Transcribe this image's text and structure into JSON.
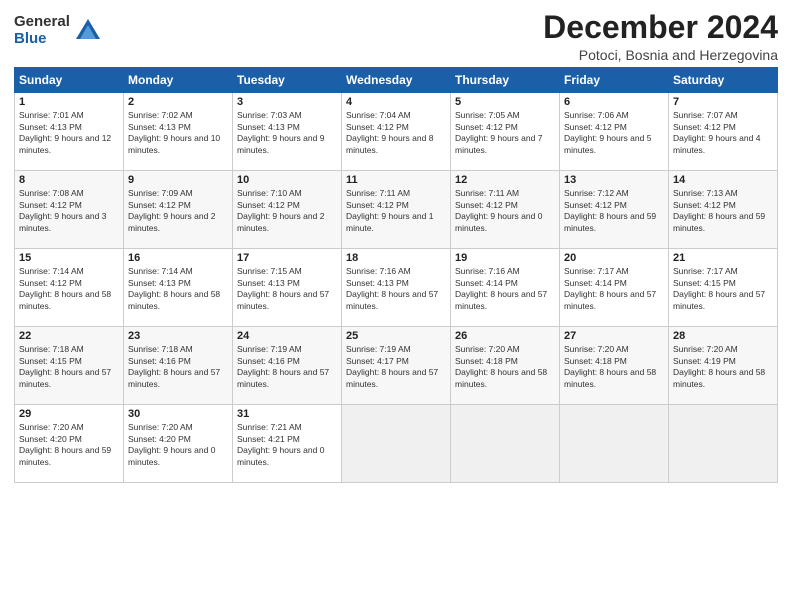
{
  "logo": {
    "general": "General",
    "blue": "Blue"
  },
  "title": "December 2024",
  "location": "Potoci, Bosnia and Herzegovina",
  "days_of_week": [
    "Sunday",
    "Monday",
    "Tuesday",
    "Wednesday",
    "Thursday",
    "Friday",
    "Saturday"
  ],
  "weeks": [
    [
      {
        "day": "1",
        "sunrise": "7:01 AM",
        "sunset": "4:13 PM",
        "daylight": "9 hours and 12 minutes."
      },
      {
        "day": "2",
        "sunrise": "7:02 AM",
        "sunset": "4:13 PM",
        "daylight": "9 hours and 10 minutes."
      },
      {
        "day": "3",
        "sunrise": "7:03 AM",
        "sunset": "4:13 PM",
        "daylight": "9 hours and 9 minutes."
      },
      {
        "day": "4",
        "sunrise": "7:04 AM",
        "sunset": "4:12 PM",
        "daylight": "9 hours and 8 minutes."
      },
      {
        "day": "5",
        "sunrise": "7:05 AM",
        "sunset": "4:12 PM",
        "daylight": "9 hours and 7 minutes."
      },
      {
        "day": "6",
        "sunrise": "7:06 AM",
        "sunset": "4:12 PM",
        "daylight": "9 hours and 5 minutes."
      },
      {
        "day": "7",
        "sunrise": "7:07 AM",
        "sunset": "4:12 PM",
        "daylight": "9 hours and 4 minutes."
      }
    ],
    [
      {
        "day": "8",
        "sunrise": "7:08 AM",
        "sunset": "4:12 PM",
        "daylight": "9 hours and 3 minutes."
      },
      {
        "day": "9",
        "sunrise": "7:09 AM",
        "sunset": "4:12 PM",
        "daylight": "9 hours and 2 minutes."
      },
      {
        "day": "10",
        "sunrise": "7:10 AM",
        "sunset": "4:12 PM",
        "daylight": "9 hours and 2 minutes."
      },
      {
        "day": "11",
        "sunrise": "7:11 AM",
        "sunset": "4:12 PM",
        "daylight": "9 hours and 1 minute."
      },
      {
        "day": "12",
        "sunrise": "7:11 AM",
        "sunset": "4:12 PM",
        "daylight": "9 hours and 0 minutes."
      },
      {
        "day": "13",
        "sunrise": "7:12 AM",
        "sunset": "4:12 PM",
        "daylight": "8 hours and 59 minutes."
      },
      {
        "day": "14",
        "sunrise": "7:13 AM",
        "sunset": "4:12 PM",
        "daylight": "8 hours and 59 minutes."
      }
    ],
    [
      {
        "day": "15",
        "sunrise": "7:14 AM",
        "sunset": "4:12 PM",
        "daylight": "8 hours and 58 minutes."
      },
      {
        "day": "16",
        "sunrise": "7:14 AM",
        "sunset": "4:13 PM",
        "daylight": "8 hours and 58 minutes."
      },
      {
        "day": "17",
        "sunrise": "7:15 AM",
        "sunset": "4:13 PM",
        "daylight": "8 hours and 57 minutes."
      },
      {
        "day": "18",
        "sunrise": "7:16 AM",
        "sunset": "4:13 PM",
        "daylight": "8 hours and 57 minutes."
      },
      {
        "day": "19",
        "sunrise": "7:16 AM",
        "sunset": "4:14 PM",
        "daylight": "8 hours and 57 minutes."
      },
      {
        "day": "20",
        "sunrise": "7:17 AM",
        "sunset": "4:14 PM",
        "daylight": "8 hours and 57 minutes."
      },
      {
        "day": "21",
        "sunrise": "7:17 AM",
        "sunset": "4:15 PM",
        "daylight": "8 hours and 57 minutes."
      }
    ],
    [
      {
        "day": "22",
        "sunrise": "7:18 AM",
        "sunset": "4:15 PM",
        "daylight": "8 hours and 57 minutes."
      },
      {
        "day": "23",
        "sunrise": "7:18 AM",
        "sunset": "4:16 PM",
        "daylight": "8 hours and 57 minutes."
      },
      {
        "day": "24",
        "sunrise": "7:19 AM",
        "sunset": "4:16 PM",
        "daylight": "8 hours and 57 minutes."
      },
      {
        "day": "25",
        "sunrise": "7:19 AM",
        "sunset": "4:17 PM",
        "daylight": "8 hours and 57 minutes."
      },
      {
        "day": "26",
        "sunrise": "7:20 AM",
        "sunset": "4:18 PM",
        "daylight": "8 hours and 58 minutes."
      },
      {
        "day": "27",
        "sunrise": "7:20 AM",
        "sunset": "4:18 PM",
        "daylight": "8 hours and 58 minutes."
      },
      {
        "day": "28",
        "sunrise": "7:20 AM",
        "sunset": "4:19 PM",
        "daylight": "8 hours and 58 minutes."
      }
    ],
    [
      {
        "day": "29",
        "sunrise": "7:20 AM",
        "sunset": "4:20 PM",
        "daylight": "8 hours and 59 minutes."
      },
      {
        "day": "30",
        "sunrise": "7:20 AM",
        "sunset": "4:20 PM",
        "daylight": "9 hours and 0 minutes."
      },
      {
        "day": "31",
        "sunrise": "7:21 AM",
        "sunset": "4:21 PM",
        "daylight": "9 hours and 0 minutes."
      },
      null,
      null,
      null,
      null
    ]
  ]
}
